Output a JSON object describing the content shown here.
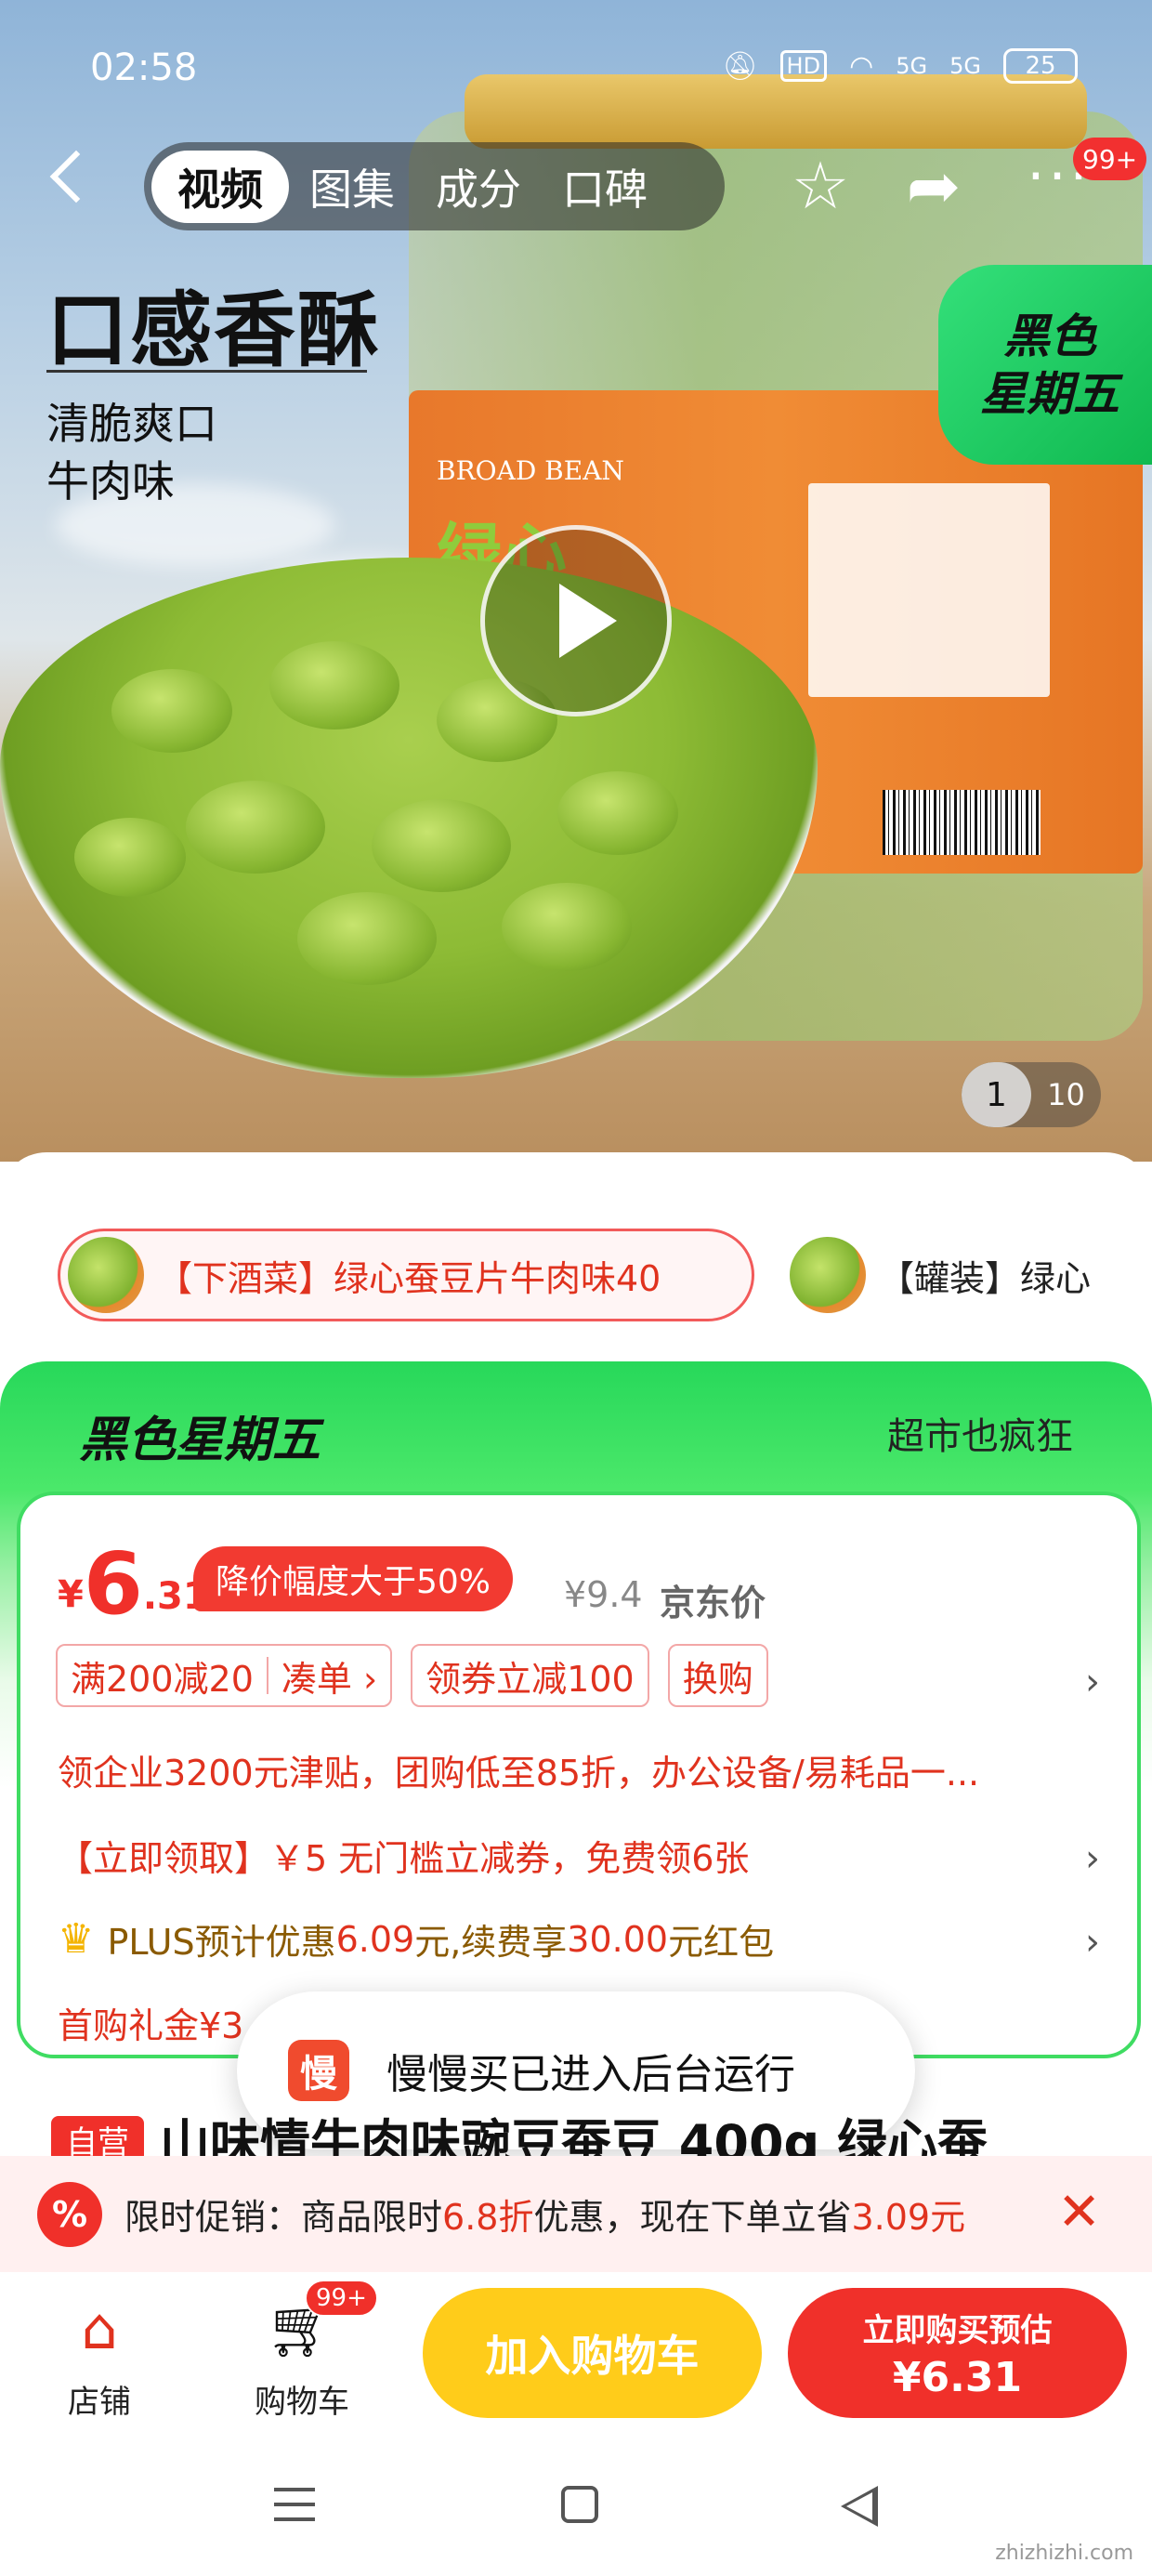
{
  "status_bar": {
    "time": "02:58",
    "hd": "HD",
    "net1": "5G",
    "net2": "5G",
    "battery": "25"
  },
  "nav": {
    "tabs": [
      {
        "label": "视频",
        "active": true
      },
      {
        "label": "图集",
        "active": false
      },
      {
        "label": "成分",
        "active": false
      },
      {
        "label": "口碑",
        "active": false
      }
    ],
    "more_badge": "99+",
    "icons": {
      "back": "back-arrow-icon",
      "favorite": "star-icon",
      "share": "share-icon",
      "more": "more-dots-icon"
    }
  },
  "hero": {
    "headline": "口感香酥",
    "sub1": "清脆爽口",
    "sub2": "牛肉味",
    "badge_line1": "黑色",
    "badge_line2": "星期五",
    "jar_label": "BROAD BEAN",
    "jar_name": "绿心",
    "page_current": "1",
    "page_total": "10"
  },
  "variants": [
    {
      "label": "【下酒菜】绿心蚕豆片牛肉味40",
      "selected": true
    },
    {
      "label": "【罐装】绿心",
      "selected": false
    }
  ],
  "promo": {
    "title": "黑色星期五",
    "slogan": "超市也疯狂",
    "price_symbol": "¥",
    "price_int": "6",
    "price_dec": ".31",
    "drop_badge": "降价幅度大于50%",
    "orig_price": "¥9.4",
    "orig_label": "京东价",
    "coupons": {
      "c1a": "满200减20",
      "c1b": "凑单 ›",
      "c2": "领券立减100",
      "c3": "换购"
    },
    "line1": "领企业3200元津贴，团购低至85折，办公设备/易耗品一...",
    "line2": "【立即领取】￥5 无门槛立减券，免费领6张",
    "plus": {
      "p1": "PLUS预计优惠",
      "v1": "6.09",
      "p2": "元,续费享",
      "v2": "30.00",
      "p3": "元红包"
    },
    "line4": "首购礼金¥3"
  },
  "toast": {
    "logo": "慢",
    "text": "慢慢买已进入后台运行"
  },
  "product": {
    "tag": "自营",
    "title": "山味情牛肉味豌豆蚕豆 400g 绿心蚕"
  },
  "limit": {
    "icon": "%",
    "t1": "限时促销：商品限时",
    "v1": "6.8折",
    "t2": "优惠，现在下单立省",
    "v2": "3.09元",
    "close": "✕"
  },
  "actions": {
    "shop": "店铺",
    "cart": "购物车",
    "cart_badge": "99+",
    "add_cart": "加入购物车",
    "buy_line1": "立即购买预估",
    "buy_line2": "¥6.31"
  },
  "watermark": "zhizhizhi.com",
  "colors": {
    "accent_red": "#f0302a",
    "friday_green": "#27d85a",
    "add_cart_yellow": "#ffcc1a"
  }
}
